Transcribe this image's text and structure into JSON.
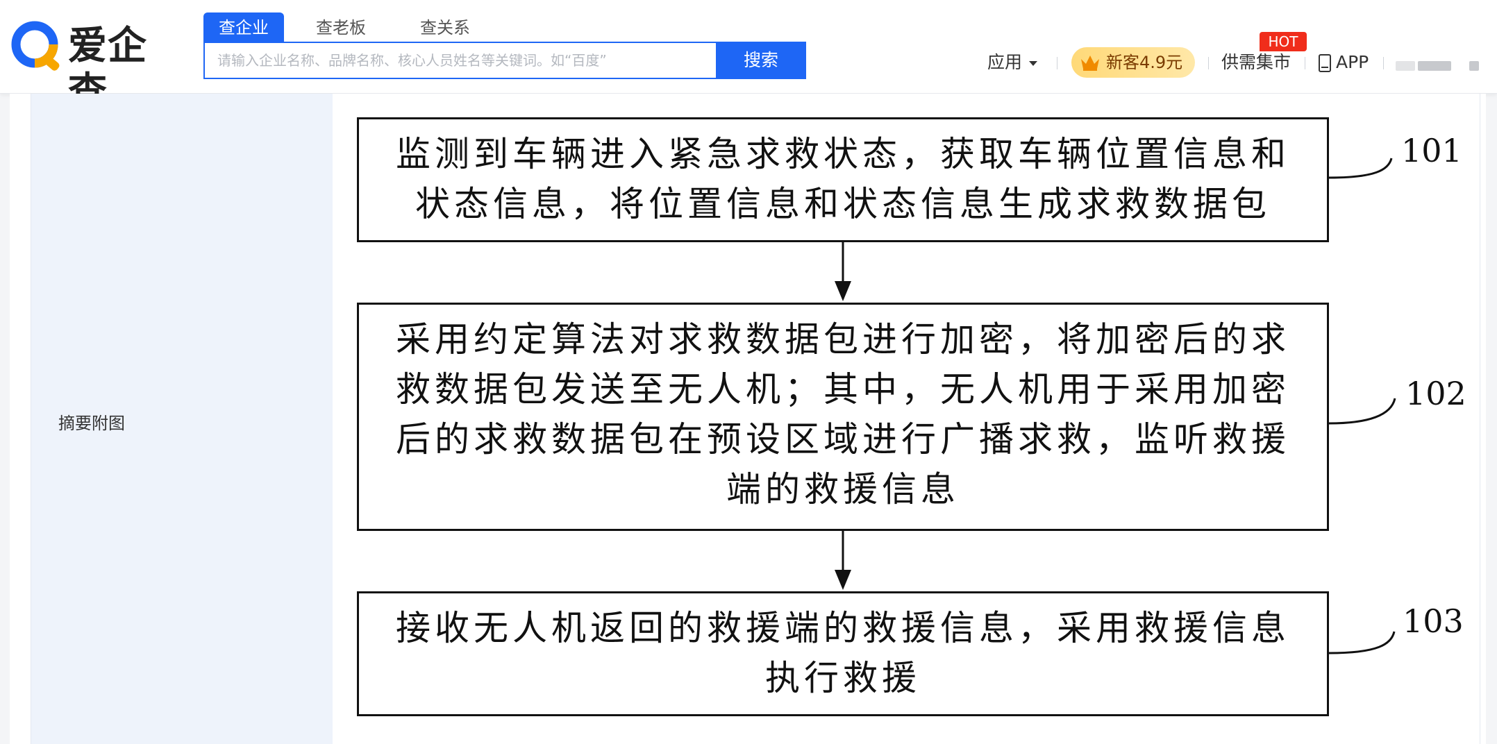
{
  "header": {
    "logo_text": "爱企查",
    "tabs": [
      {
        "label": "查企业",
        "active": true
      },
      {
        "label": "查老板",
        "active": false
      },
      {
        "label": "查关系",
        "active": false
      }
    ],
    "search": {
      "placeholder": "请输入企业名称、品牌名称、核心人员姓名等关键词。如“百度”",
      "button_label": "搜索"
    },
    "nav": {
      "apps_label": "应用",
      "promo_label": "新客4.9元",
      "market_label": "供需集市",
      "hot_badge": "HOT",
      "app_label": "APP"
    }
  },
  "detail": {
    "field_label": "摘要附图",
    "flowchart": {
      "steps": [
        {
          "id": "101",
          "lines": [
            "监测到车辆进入紧急求救状态，获取车辆位置信息和",
            "状态信息，将位置信息和状态信息生成求救数据包"
          ]
        },
        {
          "id": "102",
          "lines": [
            "采用约定算法对求救数据包进行加密，将加密后的求",
            "救数据包发送至无人机；其中，无人机用于采用加密",
            "后的求救数据包在预设区域进行广播求救，监听救援",
            "端的救援信息"
          ]
        },
        {
          "id": "103",
          "lines": [
            "接收无人机返回的救援端的救援信息，采用救援信息",
            "执行救援"
          ]
        }
      ]
    }
  },
  "colors": {
    "brand_blue": "#1e66f5",
    "hot_red": "#f02d1b",
    "promo_gold": "#ffd978",
    "label_bg": "#eef3fb"
  }
}
